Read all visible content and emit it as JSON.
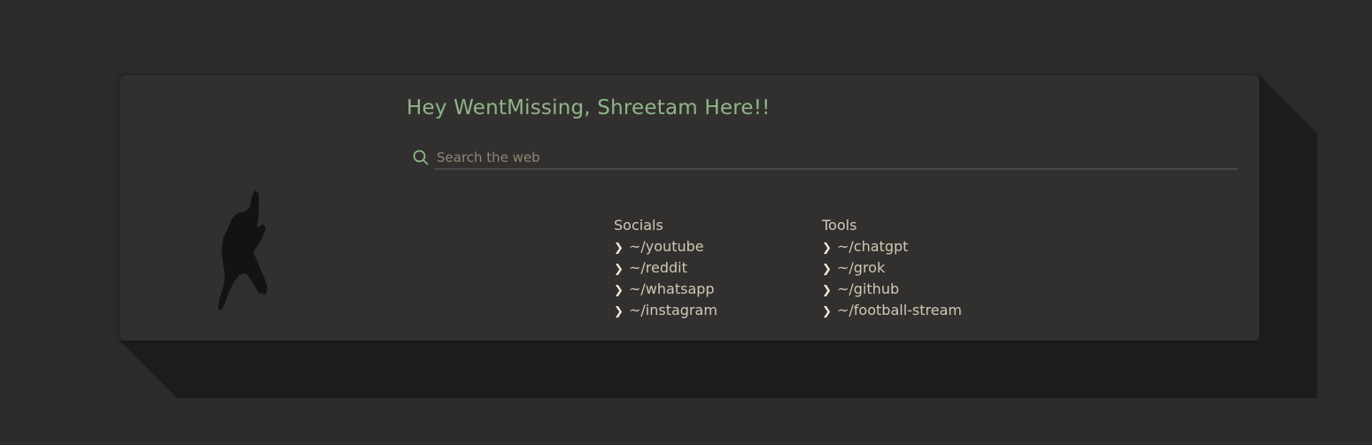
{
  "colors": {
    "background": "#2b2b2b",
    "card": "#32302e",
    "accent_green": "#8fb58a",
    "text": "#d0c9b8"
  },
  "header": {
    "greeting": "Hey WentMissing, Shreetam Here!!"
  },
  "search": {
    "placeholder": "Search the web",
    "value": "",
    "icon": "search-icon"
  },
  "figure": {
    "icon": "climbing-silhouette-figure"
  },
  "groups": [
    {
      "title": "Socials",
      "links": [
        {
          "chevron": "❯",
          "label": "~/youtube"
        },
        {
          "chevron": "❯",
          "label": "~/reddit"
        },
        {
          "chevron": "❯",
          "label": "~/whatsapp"
        },
        {
          "chevron": "❯",
          "label": "~/instagram"
        }
      ]
    },
    {
      "title": "Tools",
      "links": [
        {
          "chevron": "❯",
          "label": "~/chatgpt"
        },
        {
          "chevron": "❯",
          "label": "~/grok"
        },
        {
          "chevron": "❯",
          "label": "~/github"
        },
        {
          "chevron": "❯",
          "label": "~/football-stream"
        }
      ]
    }
  ]
}
